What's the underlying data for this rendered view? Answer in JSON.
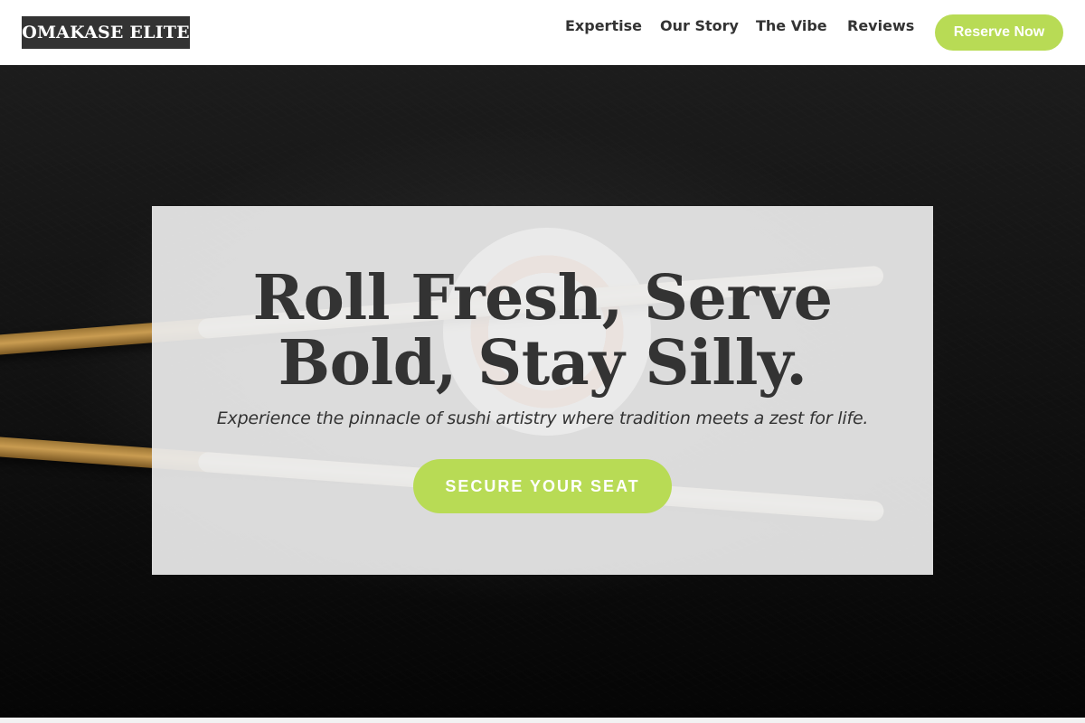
{
  "header": {
    "logo_text": "OMAKASE ELITE",
    "nav": [
      {
        "label": "Expertise"
      },
      {
        "label": "Our Story"
      },
      {
        "label": "The Vibe"
      },
      {
        "label": "Reviews"
      }
    ],
    "reserve_label": "Reserve Now"
  },
  "hero": {
    "title": "Roll Fresh, Serve Bold, Stay Silly.",
    "subtitle": "Experience the pinnacle of sushi artistry where tradition meets a zest for life.",
    "cta_label": "SECURE YOUR SEAT"
  },
  "colors": {
    "accent": "#b8db55",
    "text_dark": "#333333",
    "header_bg": "#ffffff",
    "card_bg": "#ebebeb"
  }
}
